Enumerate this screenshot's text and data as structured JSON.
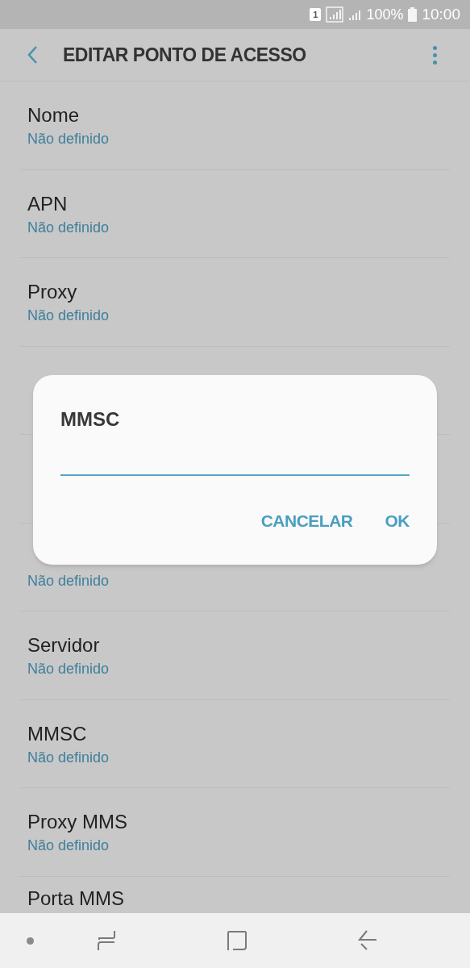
{
  "status_bar": {
    "sim": "1",
    "battery_text": "100%",
    "time": "10:00"
  },
  "header": {
    "title": "EDITAR PONTO DE ACESSO"
  },
  "settings": [
    {
      "title": "Nome",
      "value": "Não definido"
    },
    {
      "title": "APN",
      "value": "Não definido"
    },
    {
      "title": "Proxy",
      "value": "Não definido"
    },
    {
      "kind": "covered"
    },
    {
      "kind": "covered"
    },
    {
      "kind": "row",
      "value": "Não definido"
    },
    {
      "title": "Servidor",
      "value": "Não definido"
    },
    {
      "title": "MMSC",
      "value": "Não definido"
    },
    {
      "title": "Proxy MMS",
      "value": "Não definido"
    },
    {
      "title": "Porta MMS"
    }
  ],
  "dialog": {
    "title": "MMSC",
    "buttons": [
      "CANCELAR",
      "OK"
    ]
  }
}
